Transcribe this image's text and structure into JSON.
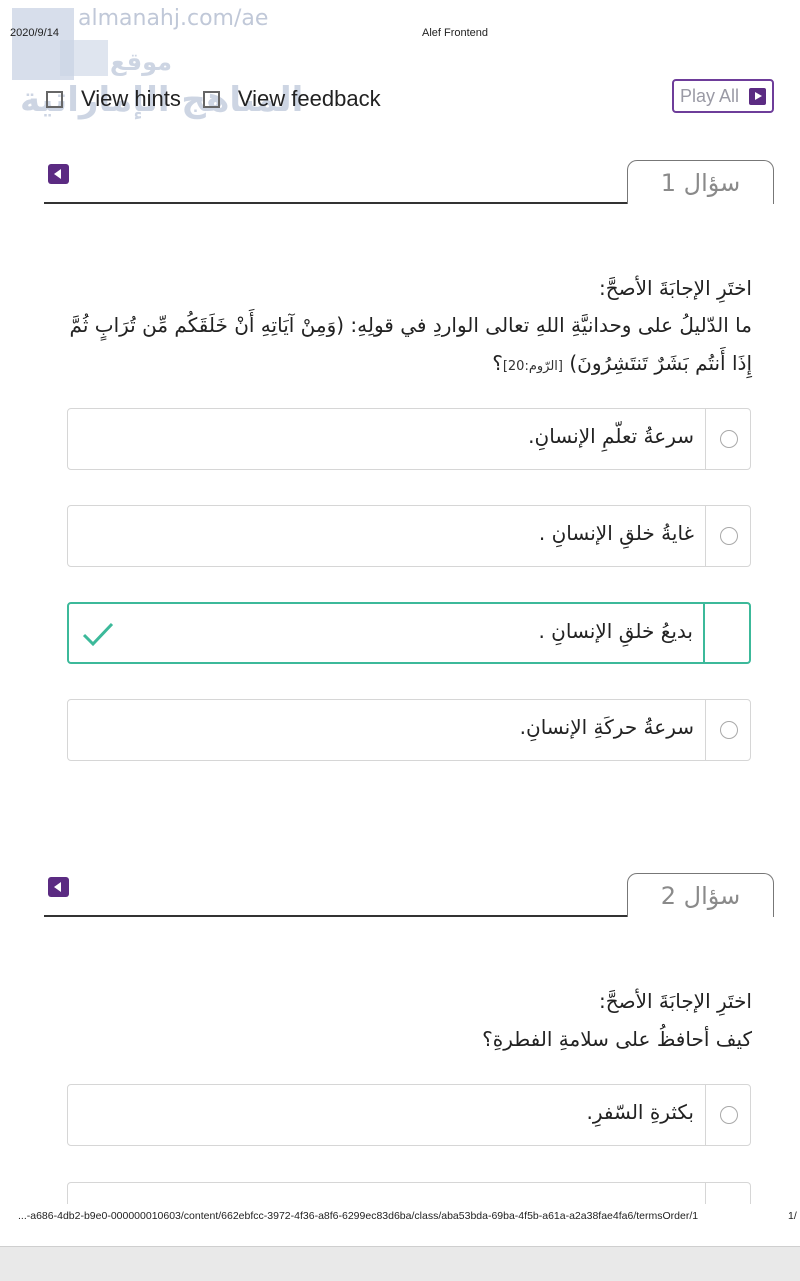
{
  "print_header": {
    "date": "2020/9/14",
    "title": "Alef Frontend"
  },
  "watermark": {
    "url": "almanahj.com/ae",
    "arabic_line1": "موقع",
    "arabic_line2": "المناهج الإماراتية"
  },
  "controls": {
    "view_hints_label": "View hints",
    "view_feedback_label": "View feedback",
    "play_all_label": "Play All",
    "accent_color": "#5b2b82"
  },
  "questions": [
    {
      "tab_label": "سؤال 1",
      "instruction": "اختَرِ الإجابَةَ الأصحَّ:",
      "text": "ما الدّليلُ على وحدانيَّةِ اللهِ تعالى الواردِ في قولِهِ: (وَمِنْ آيَاتِهِ أَنْ خَلَقَكُم مِّن تُرَابٍ ثُمَّ إِذَا أَنتُم بَشَرٌ تَنتَشِرُونَ)",
      "reference": "[الرّوم:20]",
      "text_end": "؟",
      "options": [
        {
          "label": "سرعةُ تعلّمِ الإنسانِ.",
          "correct": false
        },
        {
          "label": "غايةُ خلقِ الإنسانِ .",
          "correct": false
        },
        {
          "label": "بديعُ خلقِ الإنسانِ .",
          "correct": true
        },
        {
          "label": "سرعةُ حركَةِ الإنسانِ.",
          "correct": false
        }
      ]
    },
    {
      "tab_label": "سؤال 2",
      "instruction": "اختَرِ الإجابَةَ الأصحَّ:",
      "text": "كيف أحافظُ على سلامةِ الفطرةِ؟",
      "options": [
        {
          "label": "بكثرةِ السّفرِ.",
          "correct": false
        }
      ]
    }
  ],
  "footer": {
    "url": "...-a686-4db2-b9e0-000000010603/content/662ebfcc-3972-4f36-a8f6-6299ec83d6ba/class/aba53bda-69ba-4f5b-a61a-a2a38fae4fa6/termsOrder/1",
    "page": "1/"
  },
  "colors": {
    "correct": "#3cb99a",
    "brand": "#5b2b82"
  }
}
